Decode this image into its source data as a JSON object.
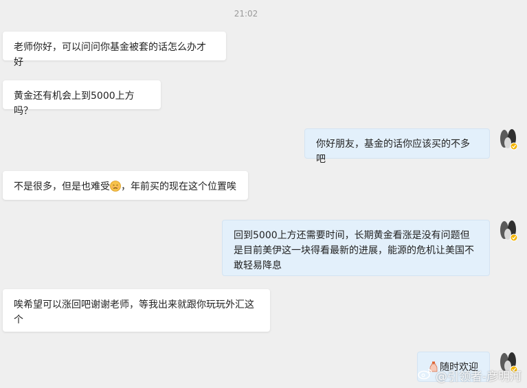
{
  "timestamp": "21:02",
  "messages": [
    {
      "side": "in",
      "text": "老师你好，可以问问你基金被套的话怎么办才好"
    },
    {
      "side": "in",
      "text": "黄金还有机会上到5000上方吗？"
    },
    {
      "side": "out",
      "text": "你好朋友，基金的话你应该买的不多吧"
    },
    {
      "side": "in",
      "text_before": "不是很多，但是也难受",
      "emoji": "unhappy-face-emoji",
      "text_after": "，年前买的现在这个位置唉"
    },
    {
      "side": "out",
      "text": "回到5000上方还需要时间，长期黄金看涨是没有问题但是目前美伊这一块得看最新的进展，能源的危机让美国不敢轻易降息"
    },
    {
      "side": "in",
      "text": "唉希望可以涨回吧谢谢老师，等我出来就跟你玩玩外汇这个"
    },
    {
      "side": "out",
      "icon": "bottle-emoji",
      "text": "随时欢迎"
    }
  ],
  "avatar_icon": "user-avatar-verified",
  "watermark": {
    "icon": "weibo-icon",
    "text": "@引领者-彦明河"
  },
  "colors": {
    "background": "#efefef",
    "incoming": "#ffffff",
    "outgoing": "#e3f0fb",
    "badge": "#f5b500"
  }
}
